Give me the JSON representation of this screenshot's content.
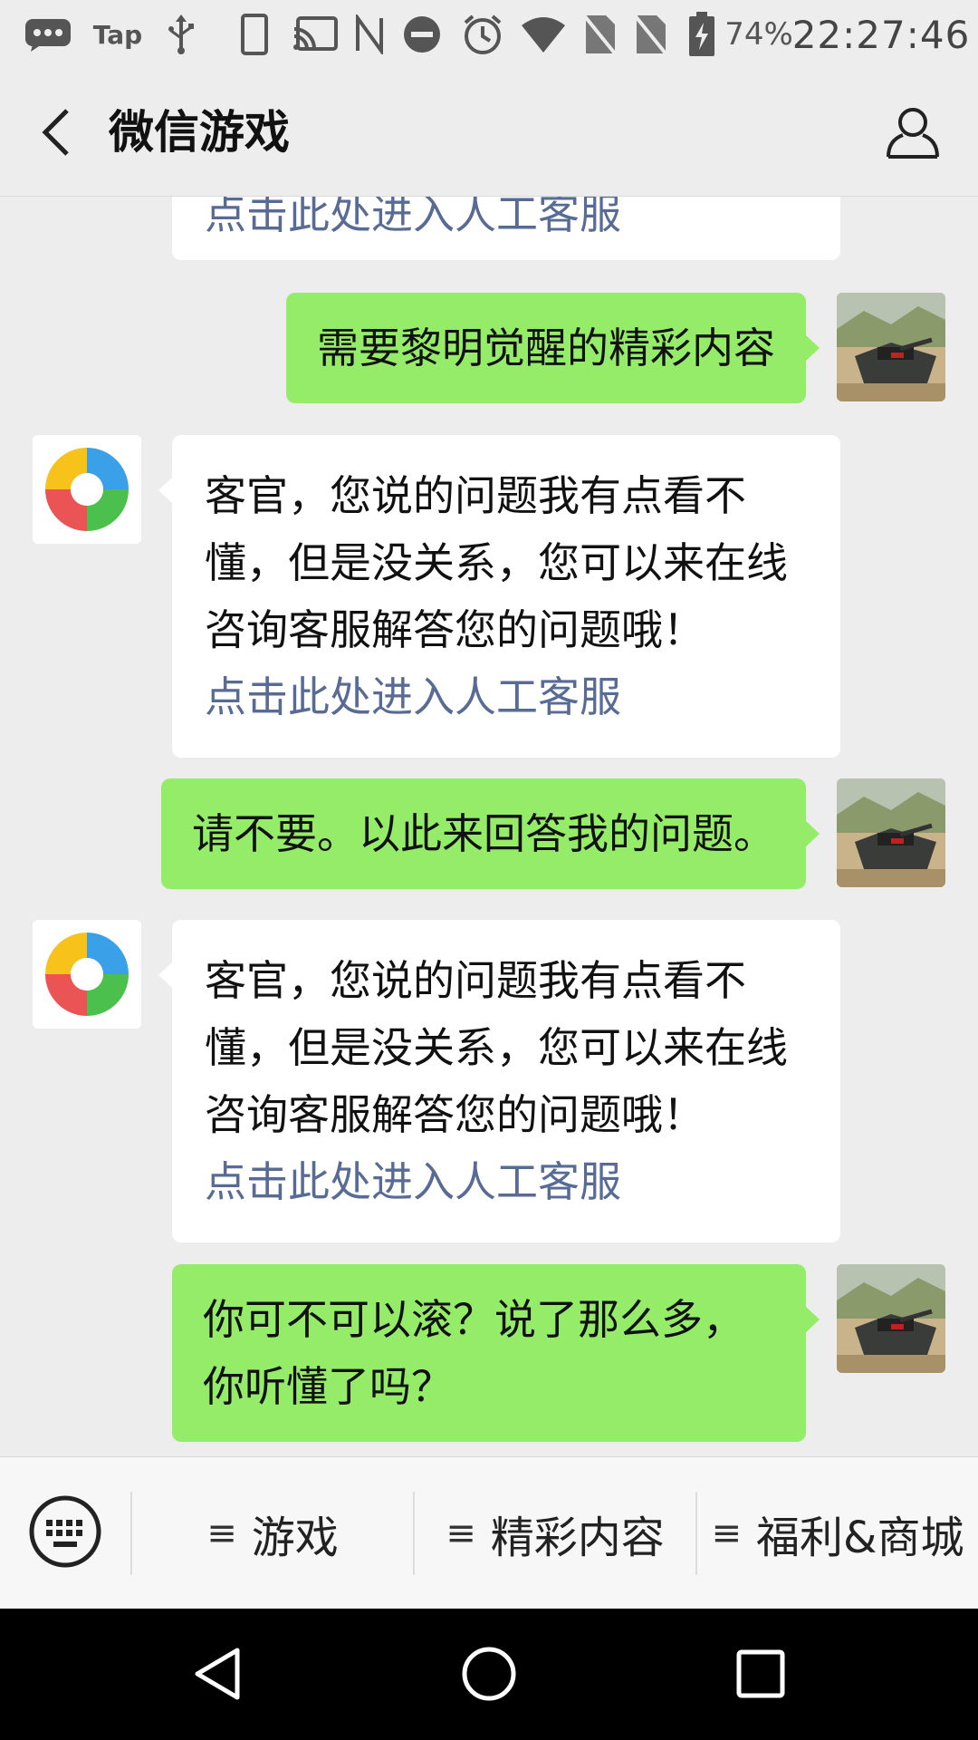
{
  "status_bar": {
    "app_label": "Tap",
    "battery_text": "74%",
    "clock": "22:27:46",
    "icons": [
      "message-icon",
      "usb-icon",
      "phone-icon",
      "cast-icon",
      "nfc-icon",
      "do-not-disturb-icon",
      "alarm-icon",
      "wifi-icon",
      "sim1-icon",
      "sim2-icon",
      "battery-charging-icon"
    ]
  },
  "header": {
    "back_icon": "chevron-left-icon",
    "title": "微信游戏",
    "profile_icon": "person-icon"
  },
  "chat": {
    "messages": [
      {
        "side": "in",
        "text": "",
        "link": "点击此处进入人工客服"
      },
      {
        "side": "out",
        "text": "需要黎明觉醒的精彩内容"
      },
      {
        "side": "in",
        "text": "客官，您说的问题我有点看不懂，但是没关系，您可以来在线咨询客服解答您的问题哦！",
        "link": "点击此处进入人工客服"
      },
      {
        "side": "out",
        "text": "请不要。以此来回答我的问题。"
      },
      {
        "side": "in",
        "text": "客官，您说的问题我有点看不懂，但是没关系，您可以来在线咨询客服解答您的问题哦！",
        "link": "点击此处进入人工客服"
      },
      {
        "side": "out",
        "text": "你可不可以滚？说了那么多，你听懂了吗？"
      }
    ]
  },
  "menu_bar": {
    "keyboard_icon": "keyboard-icon",
    "items": [
      {
        "glyph": "≡",
        "label": "游戏"
      },
      {
        "glyph": "≡",
        "label": "精彩内容"
      },
      {
        "glyph": "≡",
        "label": "福利&商城"
      }
    ]
  },
  "nav_bar": {
    "icons": [
      "back-triangle-icon",
      "home-circle-icon",
      "recents-square-icon"
    ]
  },
  "colors": {
    "background": "#ededed",
    "outgoing_bubble": "#95ec69",
    "incoming_bubble": "#ffffff",
    "link": "#576b95"
  }
}
